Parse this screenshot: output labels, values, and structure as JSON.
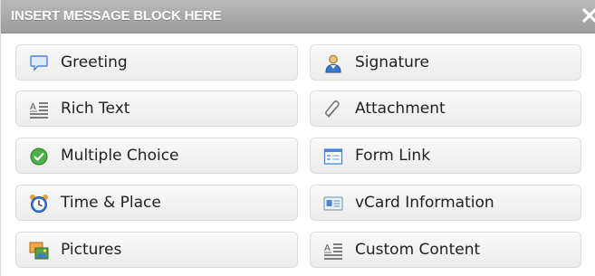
{
  "dialog": {
    "title": "INSERT MESSAGE BLOCK HERE",
    "close_icon": "close-icon"
  },
  "blocks": [
    {
      "label": "Greeting",
      "icon": "speech-bubble-icon"
    },
    {
      "label": "Signature",
      "icon": "person-icon"
    },
    {
      "label": "Rich Text",
      "icon": "rich-text-icon"
    },
    {
      "label": "Attachment",
      "icon": "paperclip-icon"
    },
    {
      "label": "Multiple Choice",
      "icon": "checkmark-circle-icon"
    },
    {
      "label": "Form Link",
      "icon": "form-icon"
    },
    {
      "label": "Time & Place",
      "icon": "alarm-clock-icon"
    },
    {
      "label": "vCard Information",
      "icon": "vcard-icon"
    },
    {
      "label": "Pictures",
      "icon": "pictures-icon"
    },
    {
      "label": "Custom Content",
      "icon": "custom-content-icon"
    }
  ],
  "colors": {
    "titlebar": "#a9a9a9",
    "button_bg": "#f1f1f1",
    "button_border": "#dcdcdc",
    "text": "#222222"
  }
}
